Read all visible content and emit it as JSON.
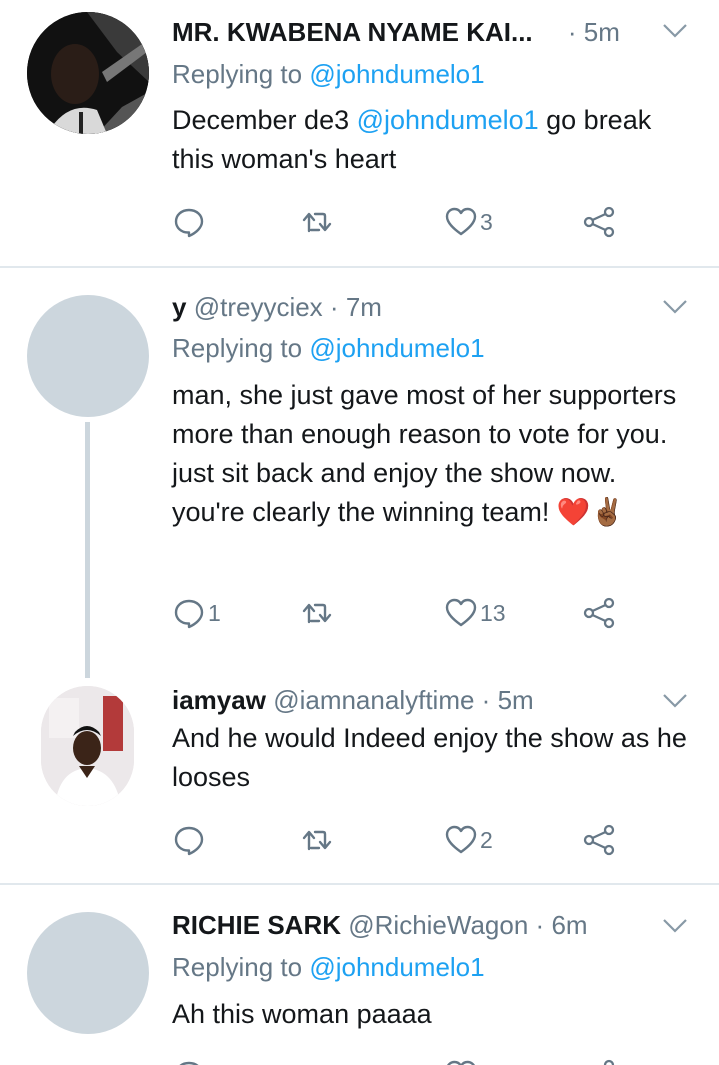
{
  "tweets": [
    {
      "name": "MR. KWABENA NYAME KAI...",
      "handle": "",
      "dot": "·",
      "time": "5m",
      "reply_prefix": "Replying to",
      "reply_to": "@johndumelo1",
      "text_parts": [
        "December de3 ",
        "@johndumelo1",
        "  go break this woman's heart"
      ],
      "reply_count": "",
      "like_count": "3"
    },
    {
      "name": "y",
      "handle": "@treyyciex",
      "dot": "·",
      "time": "7m",
      "reply_prefix": "Replying to",
      "reply_to": "@johndumelo1",
      "text": "man, she just gave most of her supporters more than enough reason to vote for you. just sit back and enjoy the show now. you're clearly the winning team! ❤️✌🏾",
      "reply_count": "1",
      "like_count": "13"
    },
    {
      "name": "iamyaw",
      "handle": "@iamnanalyftime",
      "dot": "·",
      "time": "5m",
      "text": "And he would Indeed enjoy the show as he looses",
      "reply_count": "",
      "like_count": "2"
    },
    {
      "name": "RICHIE SARK",
      "handle": "@RichieWagon",
      "dot": "·",
      "time": "6m",
      "reply_prefix": "Replying to",
      "reply_to": "@johndumelo1",
      "text": "Ah this woman paaaa"
    }
  ],
  "icons": {
    "reply": "reply-icon",
    "retweet": "retweet-icon",
    "like": "heart-icon",
    "share": "share-icon",
    "menu": "chevron-down-icon"
  },
  "colors": {
    "text": "#14171a",
    "muted": "#657786",
    "link": "#1da1f2",
    "divider": "#e1e8ed",
    "avatar_placeholder": "#ccd6dd"
  }
}
